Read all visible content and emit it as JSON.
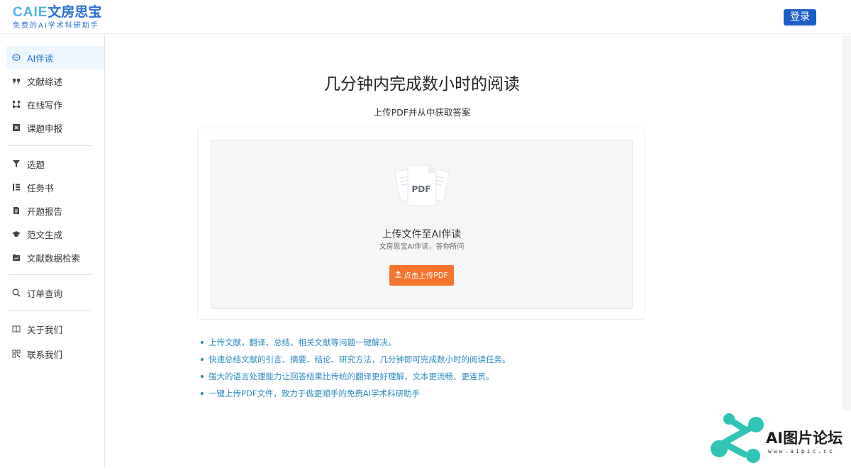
{
  "header": {
    "logo_caie": "CAIE",
    "logo_cn": "文房思宝",
    "logo_sub": "免费的AI学术科研助手",
    "login_label": "登录"
  },
  "sidebar": {
    "items": [
      {
        "label": "AI伴读",
        "icon": "chat-icon",
        "active": true
      },
      {
        "label": "文献综述",
        "icon": "quote-icon"
      },
      {
        "label": "在线写作",
        "icon": "nodes-icon"
      },
      {
        "label": "课题申报",
        "icon": "box-x-icon"
      },
      {
        "label": "选题",
        "icon": "funnel-icon"
      },
      {
        "label": "任务书",
        "icon": "list-icon"
      },
      {
        "label": "开题报告",
        "icon": "document-icon"
      },
      {
        "label": "范文生成",
        "icon": "graduation-cap-icon"
      },
      {
        "label": "文献数据检索",
        "icon": "folder-chart-icon"
      },
      {
        "label": "订单查询",
        "icon": "search-icon"
      },
      {
        "label": "关于我们",
        "icon": "book-icon"
      },
      {
        "label": "联系我们",
        "icon": "qrcode-icon"
      }
    ]
  },
  "main": {
    "title": "几分钟内完成数小时的阅读",
    "subtitle": "上传PDF并从中获取答案",
    "upload": {
      "pdf_label": "PDF",
      "title": "上传文件至AI伴读",
      "subtitle": "文房思宝AI伴读，答你所问",
      "button_label": "点击上传PDF"
    },
    "features": [
      "上传文献，翻译、总结、相关文献等问题一键解决。",
      "快速总结文献的引言、摘要、结论、研究方法，几分钟即可完成数小时的阅读任务。",
      "强大的语言处理能力让回答结果比传统的翻译更好理解，文本更流畅、更连贯。",
      "一键上传PDF文件，致力于做更顺手的免费AI学术科研助手"
    ]
  },
  "watermark": {
    "text": "AI图片论坛",
    "url": "www.aipic.cc"
  },
  "colors": {
    "brand_blue": "#1a5fc8",
    "accent_orange": "#f6742b",
    "feature_blue": "#2a8bbd",
    "active_bg": "#eef6ff",
    "watermark_teal": "#2ec4b6"
  }
}
